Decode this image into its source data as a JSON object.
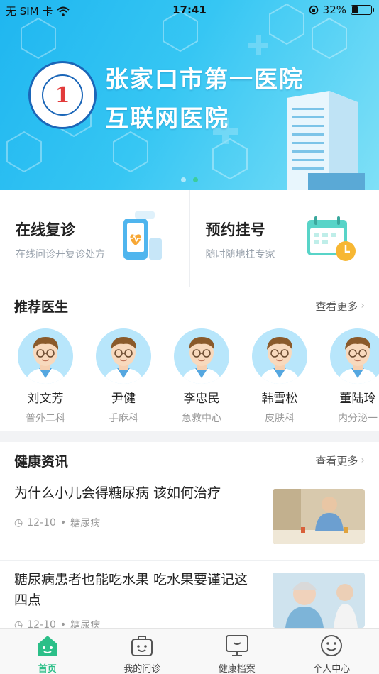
{
  "status_bar": {
    "carrier": "无 SIM 卡",
    "time": "17:41",
    "battery": "32%",
    "battery_level": 0.32
  },
  "banner": {
    "line1": "张家口市第一医院",
    "line2": "互联网医院",
    "slide_count": 2,
    "active_slide": 1
  },
  "services": [
    {
      "title": "在线复诊",
      "subtitle": "在线问诊开复诊处方",
      "icon": "phone-heart-icon"
    },
    {
      "title": "预约挂号",
      "subtitle": "随时随地挂专家",
      "icon": "calendar-clock-icon"
    }
  ],
  "doctors_section": {
    "title": "推荐医生",
    "more": "查看更多",
    "doctors": [
      {
        "name": "刘文芳",
        "dept": "普外二科"
      },
      {
        "name": "尹健",
        "dept": "手麻科"
      },
      {
        "name": "李忠民",
        "dept": "急救中心"
      },
      {
        "name": "韩雪松",
        "dept": "皮肤科"
      },
      {
        "name": "董陆玲",
        "dept": "内分泌一"
      }
    ]
  },
  "news_section": {
    "title": "健康资讯",
    "more": "查看更多",
    "items": [
      {
        "headline": "为什么小儿会得糖尿病 该如何治疗",
        "date": "12-10",
        "tag": "糖尿病"
      },
      {
        "headline": "糖尿病患者也能吃水果 吃水果要谨记这四点",
        "date": "12-10",
        "tag": "糖尿病"
      }
    ]
  },
  "tabbar": {
    "tabs": [
      {
        "label": "首页",
        "icon": "home-icon",
        "active": true
      },
      {
        "label": "我的问诊",
        "icon": "bag-icon",
        "active": false
      },
      {
        "label": "健康档案",
        "icon": "monitor-icon",
        "active": false
      },
      {
        "label": "个人中心",
        "icon": "smiley-icon",
        "active": false
      }
    ]
  },
  "colors": {
    "accent": "#2bbf88",
    "banner": "#1fb6f0"
  }
}
